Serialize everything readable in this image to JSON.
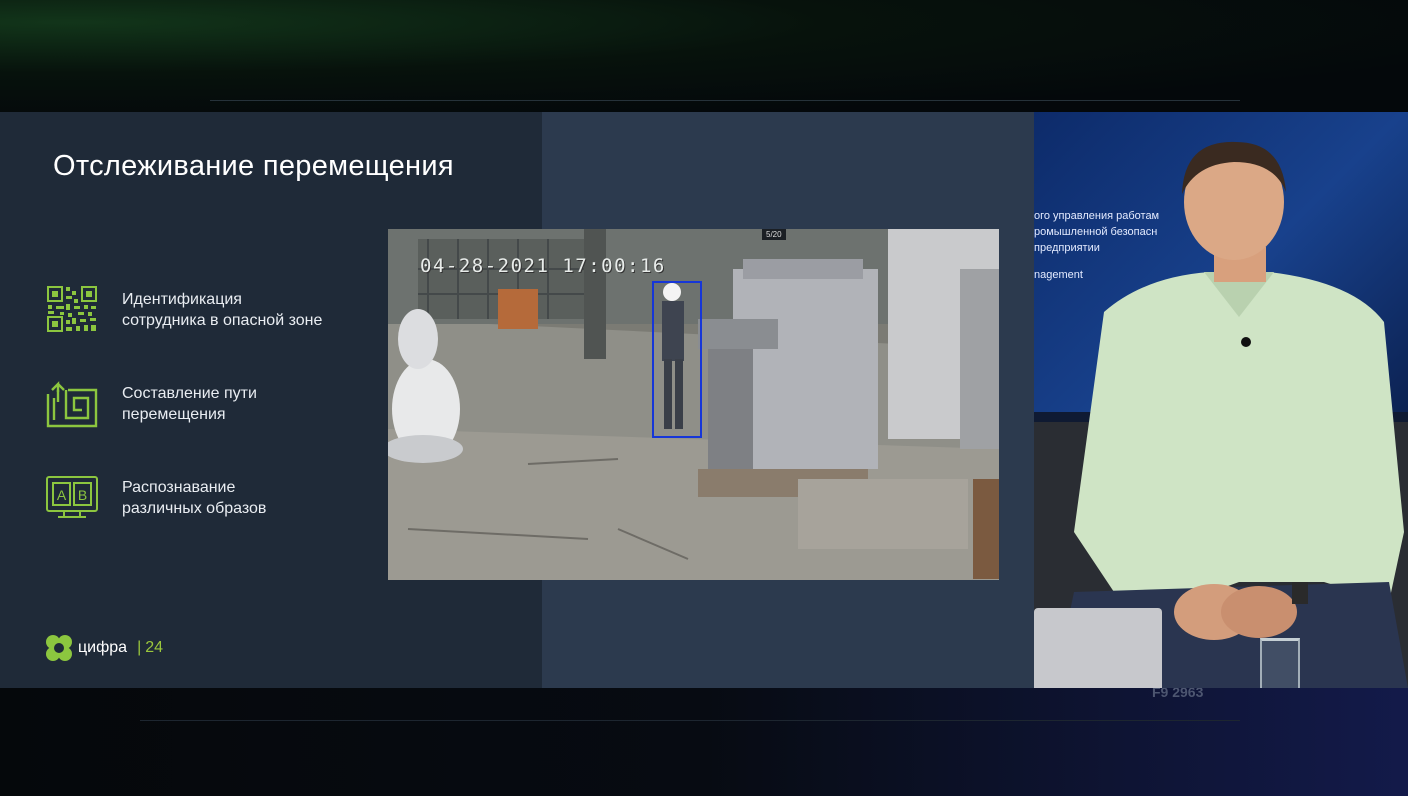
{
  "slide": {
    "title": "Отслеживание перемещения",
    "features": [
      {
        "icon": "qr-code-icon",
        "line1": "Идентификация",
        "line2": "сотрудника в опасной зоне"
      },
      {
        "icon": "path-maze-icon",
        "line1": "Составление пути",
        "line2": "перемещения"
      },
      {
        "icon": "ab-recognition-icon",
        "line1": "Распознавание",
        "line2": "различных образов"
      }
    ],
    "camera": {
      "timestamp": "04-28-2021 17:00:16",
      "counter": "5/20"
    },
    "brand": {
      "name": "цифра",
      "separator": "|",
      "page_number": "24"
    },
    "colors": {
      "accent": "#8cc63f",
      "slide_bg": "#1f2a38",
      "panel_bg": "#2c3a4e",
      "detection_box": "#1636d8"
    }
  },
  "presenter_screen": {
    "lines": [
      "ого управления работам",
      "ромышленной безопасн",
      "предприятии",
      "nagement"
    ]
  },
  "studio": {
    "ticker": "F9 2963"
  }
}
